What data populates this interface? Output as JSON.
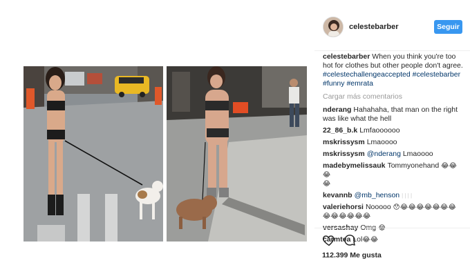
{
  "post": {
    "author": "celestebarber",
    "follow_label": "Seguir",
    "caption_author": "celestebarber",
    "caption_text": "When you think you're too hot for clothes but other people don't agree.",
    "hashtags": [
      "#celestechallengeaccepted",
      "#celestebarber",
      "#funny",
      "#emrata"
    ],
    "load_more": "Cargar más comentarios",
    "likes": "112.399 Me gusta"
  },
  "comments": [
    {
      "user": "nderang",
      "text": "Hahahaha, that man on the right was like what the hell"
    },
    {
      "user": "22_86_b.k",
      "text": "Lmfaoooooo"
    },
    {
      "user": "mskrissysm",
      "text": "Lmaoooo"
    },
    {
      "user": "mskrissysm",
      "mention": "@nderang",
      "text": "Lmaoooo"
    },
    {
      "user": "madebymelissauk",
      "text": "Tommyonehand",
      "emoji": "😂😂😂\n😂"
    },
    {
      "user": "kevannb",
      "mention": "@mb_henson",
      "faint": "| | | |"
    },
    {
      "user": "valeriehorsi",
      "text": "Nooooo",
      "emoji": "😯😂😂😂😂😂😂😂\n😂😂😂😂😂😂"
    },
    {
      "user": "versashay",
      "text": "Omg",
      "emoji": "😂"
    },
    {
      "user": "carmtea",
      "text": "Lol",
      "emoji": "😂😂"
    }
  ],
  "icons": {
    "like": "heart-icon",
    "comment": "comment-icon"
  },
  "colors": {
    "follow_button": "#3897f0",
    "hashtag": "#003569",
    "muted": "#999999",
    "text": "#262626"
  }
}
